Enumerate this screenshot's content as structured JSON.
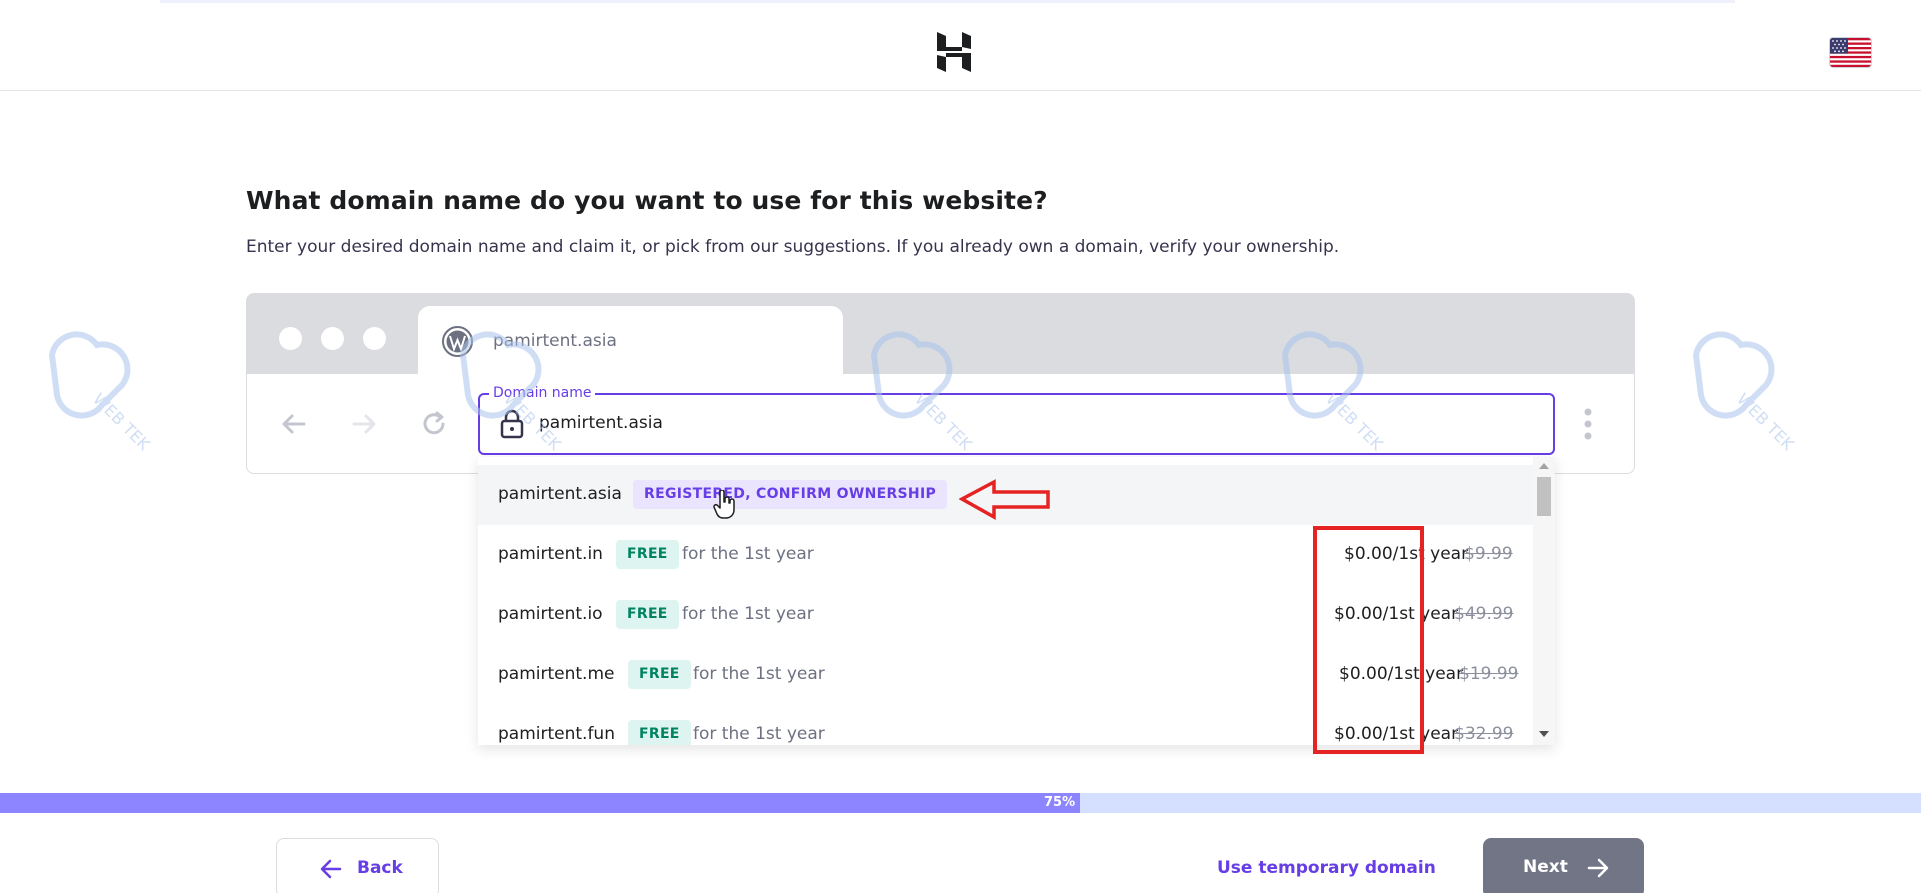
{
  "header": {
    "logo_icon": "hostinger-logo-icon",
    "language_icon": "us-flag-icon"
  },
  "main": {
    "title": "What domain name do you want to use for this website?",
    "description": "Enter your desired domain name and claim it, or pick from our suggestions. If you already own a domain, verify your ownership."
  },
  "browser_preview": {
    "tab_icon": "wordpress-icon",
    "tab_label": "pamirtent.asia"
  },
  "domain_input": {
    "label": "Domain name",
    "value": "pamirtent.asia"
  },
  "suggestions": [
    {
      "domain": "pamirtent.asia",
      "badge": "REGISTERED, CONFIRM OWNERSHIP",
      "badge_type": "registered"
    },
    {
      "domain": "pamirtent.in",
      "badge": "FREE",
      "note": "for the 1st year",
      "price": "$0.00/1st year",
      "old_price": "$9.99"
    },
    {
      "domain": "pamirtent.io",
      "badge": "FREE",
      "note": "for the 1st year",
      "price": "$0.00/1st year",
      "old_price": "$49.99"
    },
    {
      "domain": "pamirtent.me",
      "badge": "FREE",
      "note": "for the 1st year",
      "price": "$0.00/1st year",
      "old_price": "$19.99"
    },
    {
      "domain": "pamirtent.fun",
      "badge": "FREE",
      "note": "for the 1st year",
      "price": "$0.00/1st year",
      "old_price": "$32.99"
    }
  ],
  "progress": {
    "percent": 75,
    "label": "75%"
  },
  "footer": {
    "back_label": "Back",
    "temporary_domain_label": "Use temporary domain",
    "next_label": "Next"
  },
  "watermark": {
    "text": "WEB TEK"
  },
  "colors": {
    "accent": "#673de6",
    "free_badge": "#008361",
    "progress_fill": "#8c85ff",
    "annotation": "#e52323",
    "next_button": "#727586"
  }
}
